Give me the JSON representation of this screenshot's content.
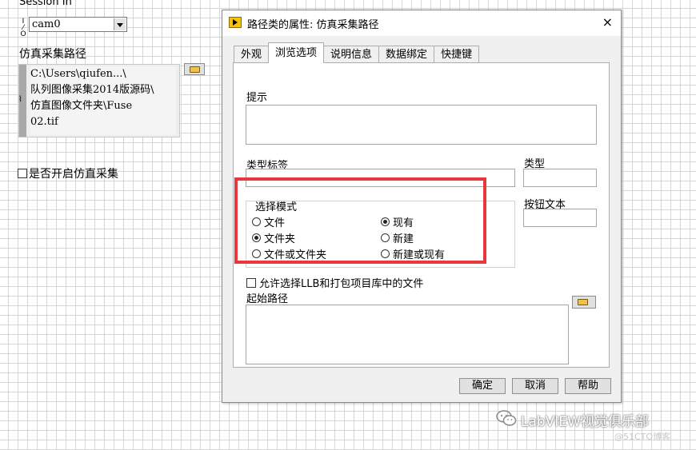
{
  "front_panel": {
    "session_label": "Session In",
    "session_io": "I/O",
    "session_value": "cam0",
    "path_label": "仿真采集路径",
    "path_value": "C:\\Users\\qiufen...\\\n队列图像采集2014版源码\\\n仿直图像文件夹\\Fuse\n02.tif",
    "sim_checkbox_label": "是否开启仿直采集"
  },
  "dialog": {
    "title": "路径类的属性: 仿真采集路径",
    "close": "×",
    "tabs": [
      {
        "label": "外观"
      },
      {
        "label": "浏览选项"
      },
      {
        "label": "说明信息"
      },
      {
        "label": "数据绑定"
      },
      {
        "label": "快捷键"
      }
    ],
    "active_tab": "浏览选项",
    "hint_label": "提示",
    "hint_value": "",
    "type_tag_label": "类型标签",
    "type_tag_value": "",
    "type_label": "类型",
    "type_value": "",
    "button_text_label": "按钮文本",
    "button_text_value": "",
    "select_mode": {
      "label": "选择模式",
      "left_options": [
        {
          "label": "文件",
          "checked": false
        },
        {
          "label": "文件夹",
          "checked": true
        },
        {
          "label": "文件或文件夹",
          "checked": false
        }
      ],
      "right_options": [
        {
          "label": "现有",
          "checked": true
        },
        {
          "label": "新建",
          "checked": false
        },
        {
          "label": "新建或现有",
          "checked": false
        }
      ]
    },
    "allow_llb_label": "允许选择LLB和打包项目库中的文件",
    "allow_llb_checked": false,
    "start_path_label": "起始路径",
    "start_path_value": "",
    "buttons": {
      "ok": "确定",
      "cancel": "取消",
      "help": "帮助"
    }
  },
  "watermark": {
    "main": "LabVIEW视觉俱乐部",
    "sub": "@51CTO博客"
  },
  "colors": {
    "highlight": "#e8383d",
    "folder_icon": "#f2c14a",
    "title_icon": "#f4c20d"
  }
}
